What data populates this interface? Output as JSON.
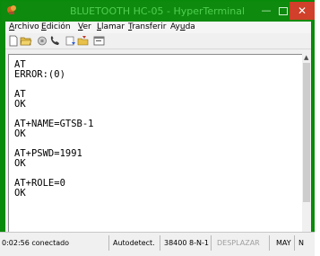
{
  "window": {
    "title": "BLUETOOTH HC-05 - HyperTerminal",
    "controls": {
      "minimize": "—",
      "close": "✕"
    },
    "colors": {
      "frame": "#0a8a0a",
      "title_text": "#4fcf4f",
      "close": "#d0402a"
    }
  },
  "menubar": {
    "items": [
      {
        "underline": "A",
        "rest": "rchivo"
      },
      {
        "underline": "E",
        "rest": "dición"
      },
      {
        "underline": "V",
        "rest": "er"
      },
      {
        "underline": "L",
        "rest": "lamar"
      },
      {
        "underline": "T",
        "rest": "ransferir"
      },
      {
        "pre": "Ay",
        "underline": "u",
        "rest": "da"
      }
    ]
  },
  "toolbar": {
    "buttons": [
      "new-document-icon",
      "open-folder-icon",
      "disconnect-icon",
      "phone-icon",
      "send-file-icon",
      "receive-file-icon",
      "properties-icon"
    ]
  },
  "terminal": {
    "lines": [
      "AT",
      "ERROR:(0)",
      "",
      "AT",
      "OK",
      "",
      "AT+NAME=GTSB-1",
      "OK",
      "",
      "AT+PSWD=1991",
      "OK",
      "",
      "AT+ROLE=0",
      "OK"
    ]
  },
  "status": {
    "time": "0:02:56 conectado",
    "detect": "Autodetect.",
    "config": "38400 8-N-1",
    "scroll": "DESPLAZAR",
    "caps": "MAY",
    "more": "N"
  }
}
